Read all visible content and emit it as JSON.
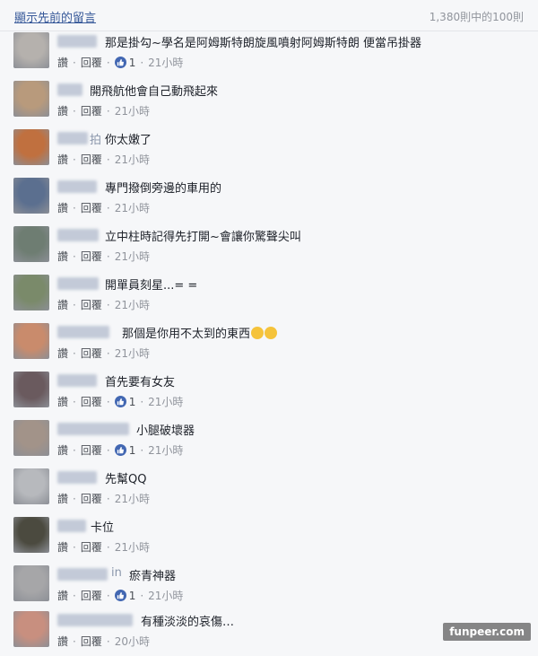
{
  "header": {
    "show_previous": "顯示先前的留言",
    "count": "1,380則中的100則"
  },
  "actions": {
    "like": "讚",
    "reply": "回覆"
  },
  "comments": [
    {
      "text": "那是掛勾~學名是阿姆斯特朗旋風噴射阿姆斯特朗 便當吊掛器",
      "likes": "1",
      "time": "21小時",
      "avatar_color": "#b5b1ad",
      "name_suffix": ""
    },
    {
      "text": "開飛航他會自己動飛起來",
      "likes": null,
      "time": "21小時",
      "avatar_color": "#b89a7c",
      "name_suffix": ""
    },
    {
      "text": "你太嫩了",
      "likes": null,
      "time": "21小時",
      "avatar_color": "#c0703f",
      "name_suffix": "拍"
    },
    {
      "text": "專門撥倒旁邊的車用的",
      "likes": null,
      "time": "21小時",
      "avatar_color": "#5b6f8f",
      "name_suffix": ""
    },
    {
      "text": "立中柱時記得先打開~會讓你驚聲尖叫",
      "likes": null,
      "time": "21小時",
      "avatar_color": "#6e7d72",
      "name_suffix": ""
    },
    {
      "text": "開單員刻星...= =",
      "likes": null,
      "time": "21小時",
      "avatar_color": "#7a8a6a",
      "name_suffix": ""
    },
    {
      "text": "那個是你用不太到的東西",
      "likes": null,
      "time": "21小時",
      "avatar_color": "#c98b6c",
      "name_suffix": "",
      "emojis": 2
    },
    {
      "text": "首先要有女友",
      "likes": "1",
      "time": "21小時",
      "avatar_color": "#6a5a5e",
      "name_suffix": ""
    },
    {
      "text": "小腿破壞器",
      "likes": "1",
      "time": "21小時",
      "avatar_color": "#a29389",
      "name_suffix": ""
    },
    {
      "text": "先幫QQ",
      "likes": null,
      "time": "21小時",
      "avatar_color": "#b7b9bd",
      "name_suffix": ""
    },
    {
      "text": "卡位",
      "likes": null,
      "time": "21小時",
      "avatar_color": "#4b4a3f",
      "name_suffix": ""
    },
    {
      "text": "瘀青神器",
      "likes": "1",
      "time": "21小時",
      "avatar_color": "#a6a6a8",
      "name_suffix": "in"
    },
    {
      "text": "有種淡淡的哀傷…",
      "likes": null,
      "time": "20小時",
      "avatar_color": "#c88f7f",
      "name_suffix": ""
    }
  ],
  "watermark": "funpeer.com"
}
